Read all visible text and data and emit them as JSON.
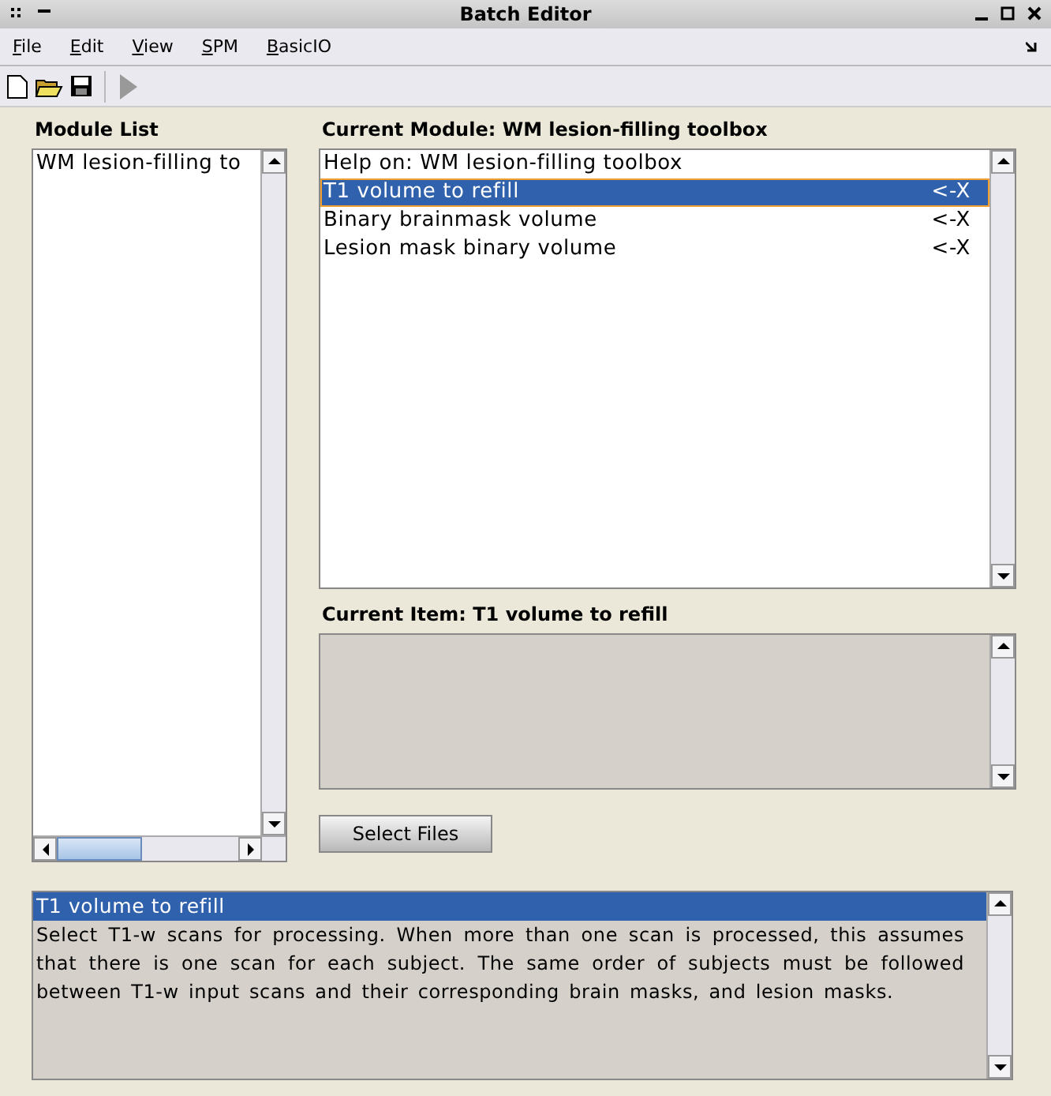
{
  "window": {
    "title": "Batch Editor"
  },
  "menu": [
    "File",
    "Edit",
    "View",
    "SPM",
    "BasicIO"
  ],
  "module_list": {
    "label": "Module List",
    "items": [
      {
        "label": "WM lesion-filling to",
        "selected": false
      }
    ]
  },
  "current_module": {
    "label": "Current Module: WM lesion-filling toolbox",
    "items": [
      {
        "label": "Help on: WM lesion-filling toolbox",
        "selected": false
      },
      {
        "label": "T1 volume to refill",
        "value": "<-X",
        "selected": true
      },
      {
        "label": "Binary brainmask volume",
        "value": "<-X",
        "selected": false
      },
      {
        "label": "Lesion mask binary volume",
        "value": "<-X",
        "selected": false
      }
    ]
  },
  "current_item": {
    "label": "Current Item: T1 volume to refill"
  },
  "select_button": "Select Files",
  "help": {
    "title": "T1 volume to refill",
    "text": "Select T1-w scans for processing. When more than one scan is processed, this assumes that there is one scan for each subject. The same order of subjects must be followed between T1-w input scans and their corresponding brain masks, and lesion masks."
  }
}
